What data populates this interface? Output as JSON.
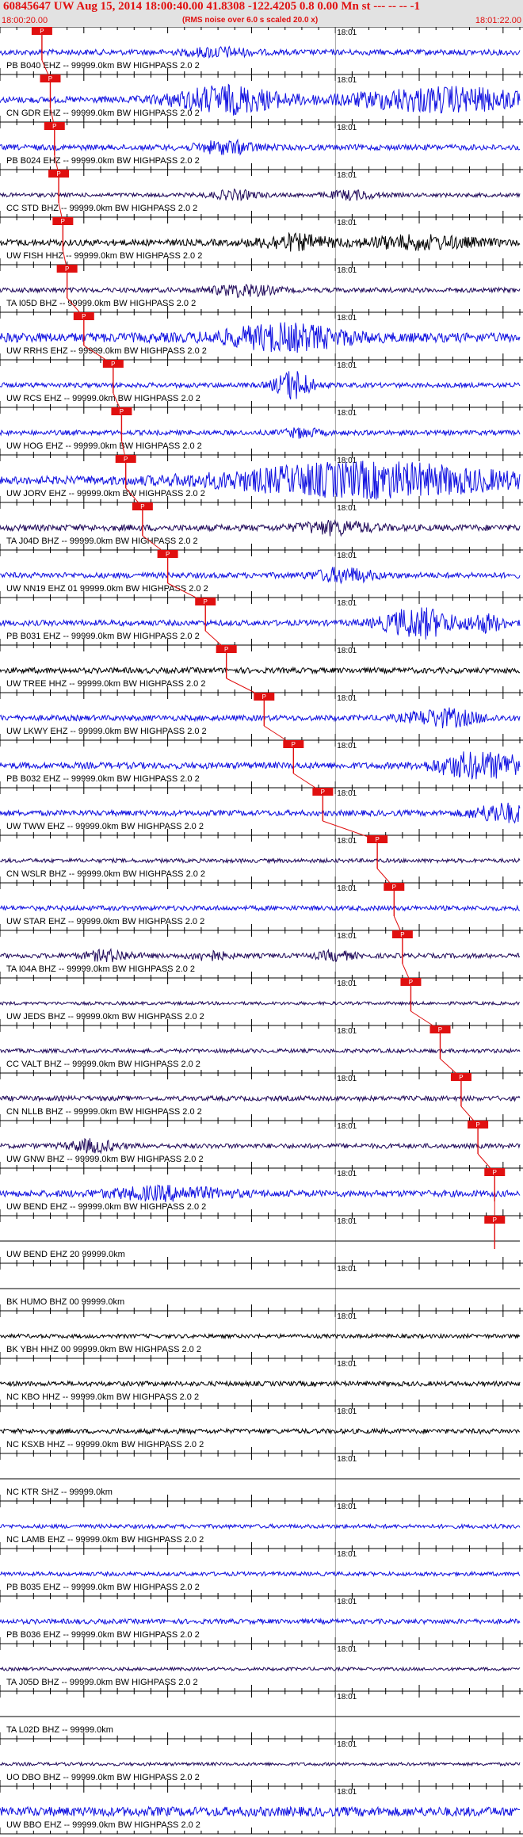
{
  "header": {
    "title": "60845647 UW Aug 15, 2014 18:00:40.00   41.8308  -122.4205  0.8 0.00 Mn st --- --  --  -1",
    "start_time": "18:00:20.00",
    "note": "(RMS noise over 6.0 s scaled 20.0 x)",
    "end_time": "18:01:22.00"
  },
  "chart_data": {
    "type": "line",
    "title": "60845647 UW Aug 15, 2014 18:00:40.00   41.8308  -122.4205  0.8 0.00 Mn st --- --  --  -1",
    "xlim": [
      "18:00:20.00",
      "18:01:22.00"
    ],
    "x_marker_label": "18:01",
    "grid": true,
    "colors": {
      "blue": "#1010e0",
      "navy": "#200a5a",
      "black": "#000000",
      "pick": "#e01010"
    },
    "traces": [
      {
        "label": "PB B040 EHZ -- 99999.0km BW  HIGHPASS  2.0  2",
        "color": "blue",
        "amp": 3.5,
        "pick_label": "P",
        "pick_time": "18:00:25.0",
        "bursts": [
          {
            "t": 26,
            "amp": 5,
            "dur": 5
          }
        ]
      },
      {
        "label": "CN GDR EHZ -- 99999.0km BW  HIGHPASS  2.0  2",
        "color": "blue",
        "amp": 4,
        "pick_label": "P",
        "pick_time": "18:00:26.0",
        "bursts": [
          {
            "t": 27,
            "amp": 16,
            "dur": 9
          },
          {
            "t": 53,
            "amp": 14,
            "dur": 16
          }
        ]
      },
      {
        "label": "PB B024 EHZ -- 99999.0km BW  HIGHPASS  2.0  2",
        "color": "blue",
        "amp": 3.5,
        "pick_label": "P",
        "pick_time": "18:00:26.5",
        "bursts": [
          {
            "t": 27,
            "amp": 7,
            "dur": 5
          },
          {
            "t": 73,
            "amp": 3,
            "dur": 8
          }
        ]
      },
      {
        "label": "CC STD BHZ -- 99999.0km BW  HIGHPASS  2.0  2",
        "color": "navy",
        "amp": 2.5,
        "pick_label": "P",
        "pick_time": "18:00:27.0",
        "bursts": [
          {
            "t": 28,
            "amp": 5,
            "dur": 4
          },
          {
            "t": 42,
            "amp": 5,
            "dur": 4
          }
        ]
      },
      {
        "label": "UW FISH HHZ -- 99999.0km BW  HIGHPASS  2.0  2",
        "color": "black",
        "amp": 4,
        "pick_label": "P",
        "pick_time": "18:00:27.5",
        "bursts": [
          {
            "t": 35,
            "amp": 8,
            "dur": 6
          },
          {
            "t": 50,
            "amp": 7,
            "dur": 10
          }
        ]
      },
      {
        "label": "TA I05D BHZ -- 99999.0km BW  HIGHPASS  2.0  2",
        "color": "navy",
        "amp": 3,
        "pick_label": "P",
        "pick_time": "18:00:28.0",
        "bursts": [
          {
            "t": 29,
            "amp": 7,
            "dur": 5
          },
          {
            "t": 82,
            "amp": 13,
            "dur": 10
          }
        ]
      },
      {
        "label": "UW RRHS EHZ -- 99999.0km BW  HIGHPASS  2.0  2",
        "color": "blue",
        "amp": 6,
        "pick_label": "P",
        "pick_time": "18:00:30.0",
        "bursts": [
          {
            "t": 34,
            "amp": 14,
            "dur": 10
          }
        ]
      },
      {
        "label": "UW RCS EHZ -- 99999.0km BW  HIGHPASS  2.0  2",
        "color": "blue",
        "amp": 3,
        "pick_label": "P",
        "pick_time": "18:00:33.5",
        "bursts": [
          {
            "t": 35,
            "amp": 18,
            "dur": 3
          }
        ]
      },
      {
        "label": "UW HOG EHZ -- 99999.0km BW  HIGHPASS  2.0  2",
        "color": "blue",
        "amp": 3,
        "pick_label": "P",
        "pick_time": "18:00:34.5",
        "bursts": [
          {
            "t": 36,
            "amp": 5,
            "dur": 3
          }
        ]
      },
      {
        "label": "UW JORV EHZ -- 99999.0km BW  HIGHPASS  2.0  2",
        "color": "blue",
        "amp": 5,
        "pick_label": "P",
        "pick_time": "18:00:35.0",
        "bursts": [
          {
            "t": 44,
            "amp": 20,
            "dur": 24
          }
        ]
      },
      {
        "label": "TA J04D BHZ -- 99999.0km BW  HIGHPASS  2.0  2",
        "color": "navy",
        "amp": 4,
        "pick_label": "P",
        "pick_time": "18:00:37.0",
        "bursts": [
          {
            "t": 40,
            "amp": 7,
            "dur": 6
          },
          {
            "t": 98,
            "amp": 14,
            "dur": 8
          }
        ]
      },
      {
        "label": "UW NN19 EHZ 01 99999.0km BW  HIGHPASS  2.0  2",
        "color": "blue",
        "amp": 3.5,
        "pick_label": "P",
        "pick_time": "18:00:40.0",
        "bursts": [
          {
            "t": 41,
            "amp": 8,
            "dur": 5
          },
          {
            "t": 92,
            "amp": 5,
            "dur": 8
          }
        ]
      },
      {
        "label": "PB B031 EHZ -- 99999.0km BW  HIGHPASS  2.0  2",
        "color": "blue",
        "amp": 3.5,
        "pick_label": "P",
        "pick_time": "18:00:44.5",
        "bursts": [
          {
            "t": 50,
            "amp": 18,
            "dur": 6
          },
          {
            "t": 58,
            "amp": 10,
            "dur": 3
          }
        ]
      },
      {
        "label": "UW TREE HHZ -- 99999.0km BW  HIGHPASS  2.0  2",
        "color": "black",
        "amp": 3.5,
        "pick_label": "P",
        "pick_time": "18:00:47.0",
        "bursts": []
      },
      {
        "label": "UW LKWY EHZ -- 99999.0km BW  HIGHPASS  2.0  2",
        "color": "blue",
        "amp": 3.5,
        "pick_label": "P",
        "pick_time": "18:00:51.5",
        "bursts": [
          {
            "t": 53,
            "amp": 10,
            "dur": 6
          }
        ]
      },
      {
        "label": "PB B032 EHZ -- 99999.0km BW  HIGHPASS  2.0  2",
        "color": "blue",
        "amp": 4,
        "pick_label": "P",
        "pick_time": "18:00:55.0",
        "bursts": [
          {
            "t": 56,
            "amp": 14,
            "dur": 6
          },
          {
            "t": 63,
            "amp": 12,
            "dur": 6
          }
        ]
      },
      {
        "label": "UW TWW EHZ -- 99999.0km BW  HIGHPASS  2.0  2",
        "color": "blue",
        "amp": 3.5,
        "pick_label": "P",
        "pick_time": "18:00:58.5",
        "bursts": [
          {
            "t": 60,
            "amp": 11,
            "dur": 5
          }
        ]
      },
      {
        "label": "CN WSLR BHZ -- 99999.0km BW  HIGHPASS  2.0  2",
        "color": "navy",
        "amp": 2.5,
        "pick_label": "P",
        "pick_time": "18:01:05.0",
        "bursts": [
          {
            "t": 73,
            "amp": 22,
            "dur": 3
          }
        ]
      },
      {
        "label": "UW STAR EHZ -- 99999.0km BW  HIGHPASS  2.0  2",
        "color": "blue",
        "amp": 3,
        "pick_label": "P",
        "pick_time": "18:01:07.0",
        "bursts": [
          {
            "t": 74,
            "amp": 9,
            "dur": 4
          }
        ]
      },
      {
        "label": "TA I04A BHZ -- 99999.0km BW  HIGHPASS  2.0  2",
        "color": "navy",
        "amp": 3,
        "pick_label": "P",
        "pick_time": "18:01:08.0",
        "bursts": [
          {
            "t": 13,
            "amp": 6,
            "dur": 4
          },
          {
            "t": 25,
            "amp": 5,
            "dur": 3
          },
          {
            "t": 40,
            "amp": 5,
            "dur": 3
          },
          {
            "t": 75,
            "amp": 8,
            "dur": 3
          }
        ]
      },
      {
        "label": "UW JEDS BHZ -- 99999.0km BW  HIGHPASS  2.0  2",
        "color": "navy",
        "amp": 2,
        "pick_label": "P",
        "pick_time": "18:01:09.0",
        "bursts": []
      },
      {
        "label": "CC VALT BHZ -- 99999.0km BW  HIGHPASS  2.0  2",
        "color": "navy",
        "amp": 2.5,
        "pick_label": "P",
        "pick_time": "18:01:12.5",
        "bursts": [
          {
            "t": 82,
            "amp": 8,
            "dur": 4
          },
          {
            "t": 92,
            "amp": 6,
            "dur": 4
          }
        ]
      },
      {
        "label": "CN NLLB BHZ -- 99999.0km BW  HIGHPASS  2.0  2",
        "color": "navy",
        "amp": 3,
        "pick_label": "P",
        "pick_time": "18:01:15.0",
        "bursts": [
          {
            "t": 82,
            "amp": 11,
            "dur": 3
          },
          {
            "t": 93,
            "amp": 13,
            "dur": 5
          }
        ]
      },
      {
        "label": "UW GNW BHZ -- 99999.0km BW  HIGHPASS  2.0  2",
        "color": "navy",
        "amp": 3,
        "pick_label": "P",
        "pick_time": "18:01:17.0",
        "bursts": [
          {
            "t": 11,
            "amp": 7,
            "dur": 4
          },
          {
            "t": 86,
            "amp": 7,
            "dur": 4
          }
        ]
      },
      {
        "label": "UW BEND EHZ -- 99999.0km BW  HIGHPASS  2.0  2",
        "color": "blue",
        "amp": 4,
        "pick_label": "P",
        "pick_time": "18:01:19.0",
        "bursts": [
          {
            "t": 20,
            "amp": 7,
            "dur": 10
          },
          {
            "t": 90,
            "amp": 8,
            "dur": 6
          }
        ]
      },
      {
        "label": "UW BEND EHZ 20 99999.0km",
        "color": "black",
        "amp": 0,
        "pick_label": "P",
        "pick_time": "18:01:19.0",
        "bursts": []
      },
      {
        "label": "BK HUMO BHZ 00 99999.0km",
        "color": "black",
        "amp": 0,
        "bursts": []
      },
      {
        "label": "BK YBH HHZ 00 99999.0km BW  HIGHPASS  2.0  2",
        "color": "black",
        "amp": 2.5,
        "bursts": []
      },
      {
        "label": "NC KBO HHZ -- 99999.0km BW  HIGHPASS  2.0  2",
        "color": "black",
        "amp": 3,
        "bursts": []
      },
      {
        "label": "NC KSXB HHZ -- 99999.0km BW  HIGHPASS  2.0  2",
        "color": "black",
        "amp": 3,
        "bursts": []
      },
      {
        "label": "NC KTR SHZ -- 99999.0km",
        "color": "black",
        "amp": 0,
        "bursts": []
      },
      {
        "label": "NC LAMB EHZ -- 99999.0km BW  HIGHPASS  2.0  2",
        "color": "blue",
        "amp": 2.5,
        "bursts": []
      },
      {
        "label": "PB B035 EHZ -- 99999.0km BW  HIGHPASS  2.0  2",
        "color": "blue",
        "amp": 2.5,
        "bursts": []
      },
      {
        "label": "PB B036 EHZ -- 99999.0km BW  HIGHPASS  2.0  2",
        "color": "blue",
        "amp": 3,
        "bursts": []
      },
      {
        "label": "TA J05D BHZ -- 99999.0km BW  HIGHPASS  2.0  2",
        "color": "navy",
        "amp": 2,
        "bursts": []
      },
      {
        "label": "TA L02D BHZ -- 99999.0km",
        "color": "black",
        "amp": 0,
        "bursts": []
      },
      {
        "label": "UO DBO BHZ -- 99999.0km BW  HIGHPASS  2.0  2",
        "color": "navy",
        "amp": 2,
        "bursts": []
      },
      {
        "label": "UW BBO EHZ -- 99999.0km BW  HIGHPASS  2.0  2",
        "color": "blue",
        "amp": 6,
        "bursts": []
      }
    ]
  }
}
